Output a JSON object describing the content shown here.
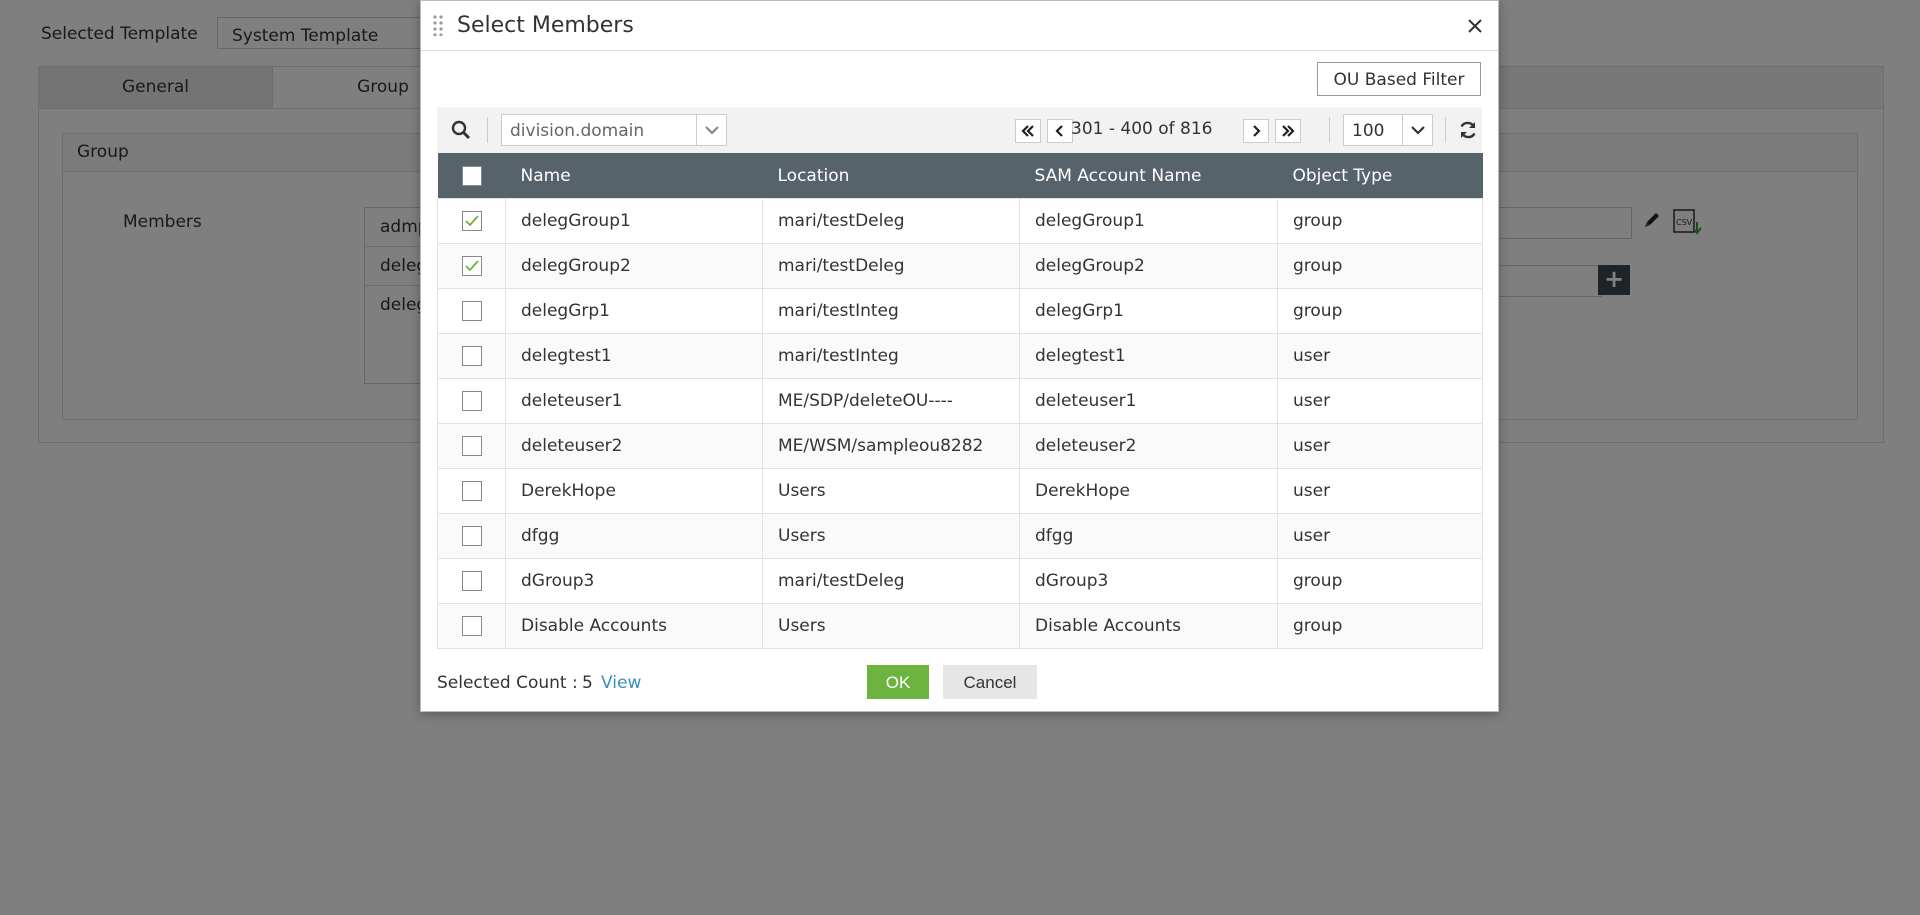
{
  "background": {
    "selected_template_label": "Selected Template",
    "selected_template_value": "System Template",
    "tabs": [
      {
        "label": "General"
      },
      {
        "label": "Group"
      }
    ],
    "group_section_title": "Group",
    "members_label": "Members",
    "members": [
      "admp",
      "deleg",
      "deleg"
    ]
  },
  "dialog": {
    "title": "Select Members",
    "ou_filter_button": "OU Based Filter",
    "domain_select": "division.domain",
    "pagination": {
      "range": "301 - 400 of 816",
      "page_size": "100"
    },
    "columns": [
      "Name",
      "Location",
      "SAM Account Name",
      "Object Type"
    ],
    "rows": [
      {
        "checked": true,
        "name": "delegGroup1",
        "location": "mari/testDeleg",
        "sam": "delegGroup1",
        "type": "group"
      },
      {
        "checked": true,
        "name": "delegGroup2",
        "location": "mari/testDeleg",
        "sam": "delegGroup2",
        "type": "group"
      },
      {
        "checked": false,
        "name": "delegGrp1",
        "location": "mari/testInteg",
        "sam": "delegGrp1",
        "type": "group"
      },
      {
        "checked": false,
        "name": "delegtest1",
        "location": "mari/testInteg",
        "sam": "delegtest1",
        "type": "user"
      },
      {
        "checked": false,
        "name": "deleteuser1",
        "location": "ME/SDP/deleteOU----",
        "sam": "deleteuser1",
        "type": "user"
      },
      {
        "checked": false,
        "name": "deleteuser2",
        "location": "ME/WSM/sampleou8282",
        "sam": "deleteuser2",
        "type": "user"
      },
      {
        "checked": false,
        "name": "DerekHope",
        "location": "Users",
        "sam": "DerekHope",
        "type": "user"
      },
      {
        "checked": false,
        "name": "dfgg",
        "location": "Users",
        "sam": "dfgg",
        "type": "user"
      },
      {
        "checked": false,
        "name": "dGroup3",
        "location": "mari/testDeleg",
        "sam": "dGroup3",
        "type": "group"
      },
      {
        "checked": false,
        "name": "Disable Accounts",
        "location": "Users",
        "sam": "Disable Accounts",
        "type": "group"
      }
    ],
    "footer": {
      "selected_count_label": "Selected Count :",
      "selected_count": "5",
      "view_link": "View",
      "ok_button": "OK",
      "cancel_button": "Cancel"
    }
  },
  "colors": {
    "header_bg": "#56636b",
    "ok_green": "#6db33f",
    "check_green": "#6db33f",
    "link_blue": "#3a8fc1"
  },
  "icons": [
    "drag-handle-icon",
    "close-icon",
    "search-icon",
    "chevron-down-icon",
    "first-page-icon",
    "prev-page-icon",
    "next-page-icon",
    "last-page-icon",
    "refresh-icon",
    "checkmark-icon",
    "edit-icon",
    "csv-export-icon",
    "plus-icon"
  ]
}
